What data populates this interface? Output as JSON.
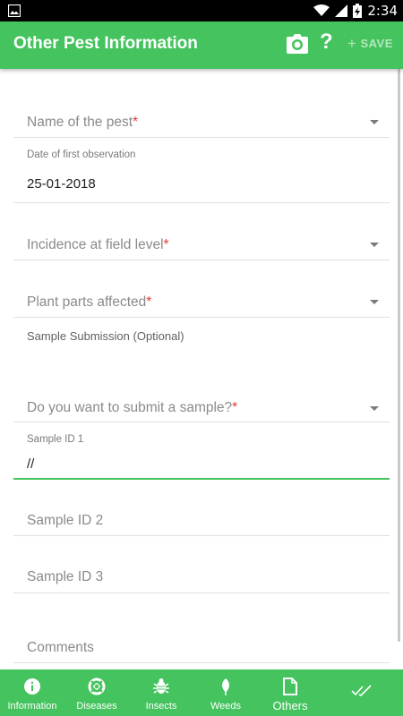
{
  "status_bar": {
    "time": "2:34"
  },
  "app_bar": {
    "title": "Other Pest Information",
    "help_label": "?",
    "save_label": "SAVE"
  },
  "form": {
    "pest_name": {
      "label": "Name of the pest",
      "required_mark": "*"
    },
    "date_first_observation": {
      "label": "Date of first observation",
      "value": "25-01-2018"
    },
    "incidence": {
      "label": "Incidence at field level",
      "required_mark": "*"
    },
    "plant_parts": {
      "label": "Plant parts affected",
      "required_mark": "*"
    },
    "sample_section": {
      "label": "Sample Submission (Optional)"
    },
    "submit_sample": {
      "label": "Do you want to submit a sample?",
      "required_mark": "*"
    },
    "sample_id_1": {
      "label": "Sample ID 1",
      "value": "//"
    },
    "sample_id_2": {
      "placeholder": "Sample ID 2"
    },
    "sample_id_3": {
      "placeholder": "Sample ID 3"
    },
    "comments": {
      "placeholder": "Comments"
    }
  },
  "bottom_nav": {
    "items": [
      {
        "label": "Information",
        "icon": "info-icon"
      },
      {
        "label": "Diseases",
        "icon": "lifebuoy-icon"
      },
      {
        "label": "Insects",
        "icon": "bug-icon"
      },
      {
        "label": "Weeds",
        "icon": "leaf-icon"
      },
      {
        "label": "Others",
        "icon": "document-icon"
      },
      {
        "label": "",
        "icon": "double-check-icon"
      }
    ],
    "active": "Others"
  },
  "colors": {
    "primary": "#44c35e",
    "required": "#e53935"
  }
}
